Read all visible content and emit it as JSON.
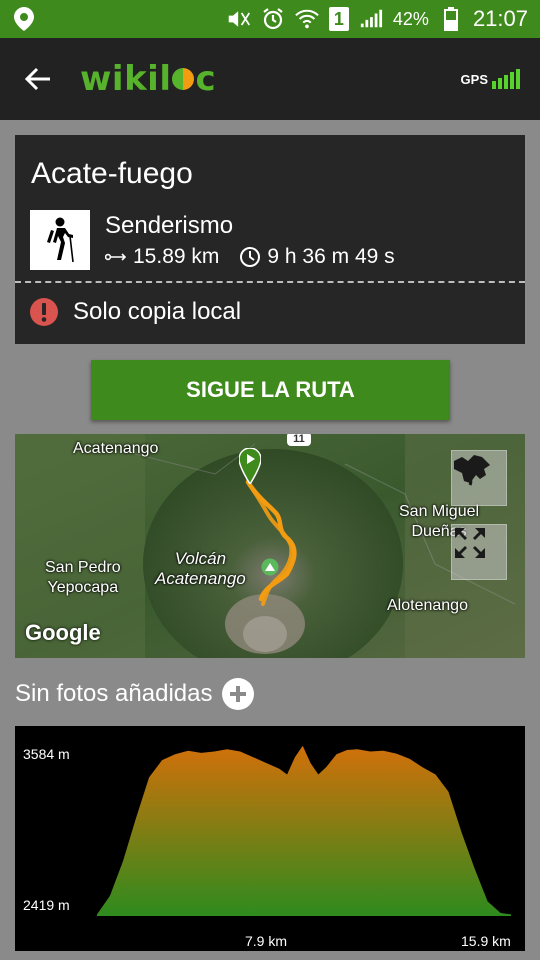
{
  "status_bar": {
    "battery_pct": "42%",
    "sim_slot": "1",
    "time": "21:07",
    "icons": [
      "location-icon",
      "mute-icon",
      "alarm-icon",
      "wifi-icon",
      "sim-icon",
      "signal-icon",
      "battery-icon"
    ]
  },
  "app_bar": {
    "logo_text_start": "wikil",
    "logo_text_end": "c",
    "gps_label": "GPS",
    "gps_level": 1.0
  },
  "track": {
    "title": "Acate-fuego",
    "activity": "Senderismo",
    "distance": "15.89 km",
    "duration": "9 h 36 m 49 s",
    "local_notice": "Solo copia local"
  },
  "follow_button": {
    "label": "SIGUE LA RUTA"
  },
  "map": {
    "places": {
      "acatenango": "Acatenango",
      "san_miguel_1": "San Miguel",
      "san_miguel_2": "Dueñas",
      "volcan_1": "Volcán",
      "volcan_2": "Acatenango",
      "san_pedro_1": "San Pedro",
      "san_pedro_2": "Yepocapa",
      "alotenango": "Alotenango"
    },
    "road_badge": "11",
    "google_label": "Google",
    "colors": {
      "track": "#f39c12",
      "start_marker": "#3f8a1c"
    }
  },
  "photos": {
    "label": "Sin fotos añadidas"
  },
  "chart_data": {
    "type": "area",
    "title": "",
    "xlabel": "",
    "ylabel": "",
    "y_tick_labels": [
      "3584 m",
      "2419 m"
    ],
    "x_tick_labels": [
      "7.9 km",
      "15.9 km"
    ],
    "ylim": [
      2419,
      3584
    ],
    "xlim": [
      0,
      15.9
    ],
    "series": [
      {
        "x": [
          0,
          0.5,
          1.0,
          1.5,
          2.0,
          2.5,
          3.0,
          3.5,
          4.0,
          4.5,
          5.0,
          5.5,
          6.0,
          6.5,
          7.0,
          7.3,
          7.6,
          7.9,
          8.2,
          8.5,
          8.8,
          9.2,
          9.6,
          10.0,
          10.5,
          11.0,
          11.5,
          12.0,
          12.5,
          13.0,
          13.5,
          14.0,
          14.5,
          15.0,
          15.5,
          15.9
        ],
        "y": [
          2430,
          2560,
          2800,
          3100,
          3380,
          3500,
          3540,
          3565,
          3550,
          3560,
          3575,
          3560,
          3520,
          3480,
          3440,
          3400,
          3520,
          3600,
          3480,
          3400,
          3450,
          3540,
          3570,
          3575,
          3560,
          3565,
          3545,
          3510,
          3450,
          3400,
          3280,
          3000,
          2750,
          2520,
          2440,
          2430
        ]
      }
    ],
    "colors": {
      "top": "#d2700a",
      "bottom": "#2e8b1e"
    }
  }
}
